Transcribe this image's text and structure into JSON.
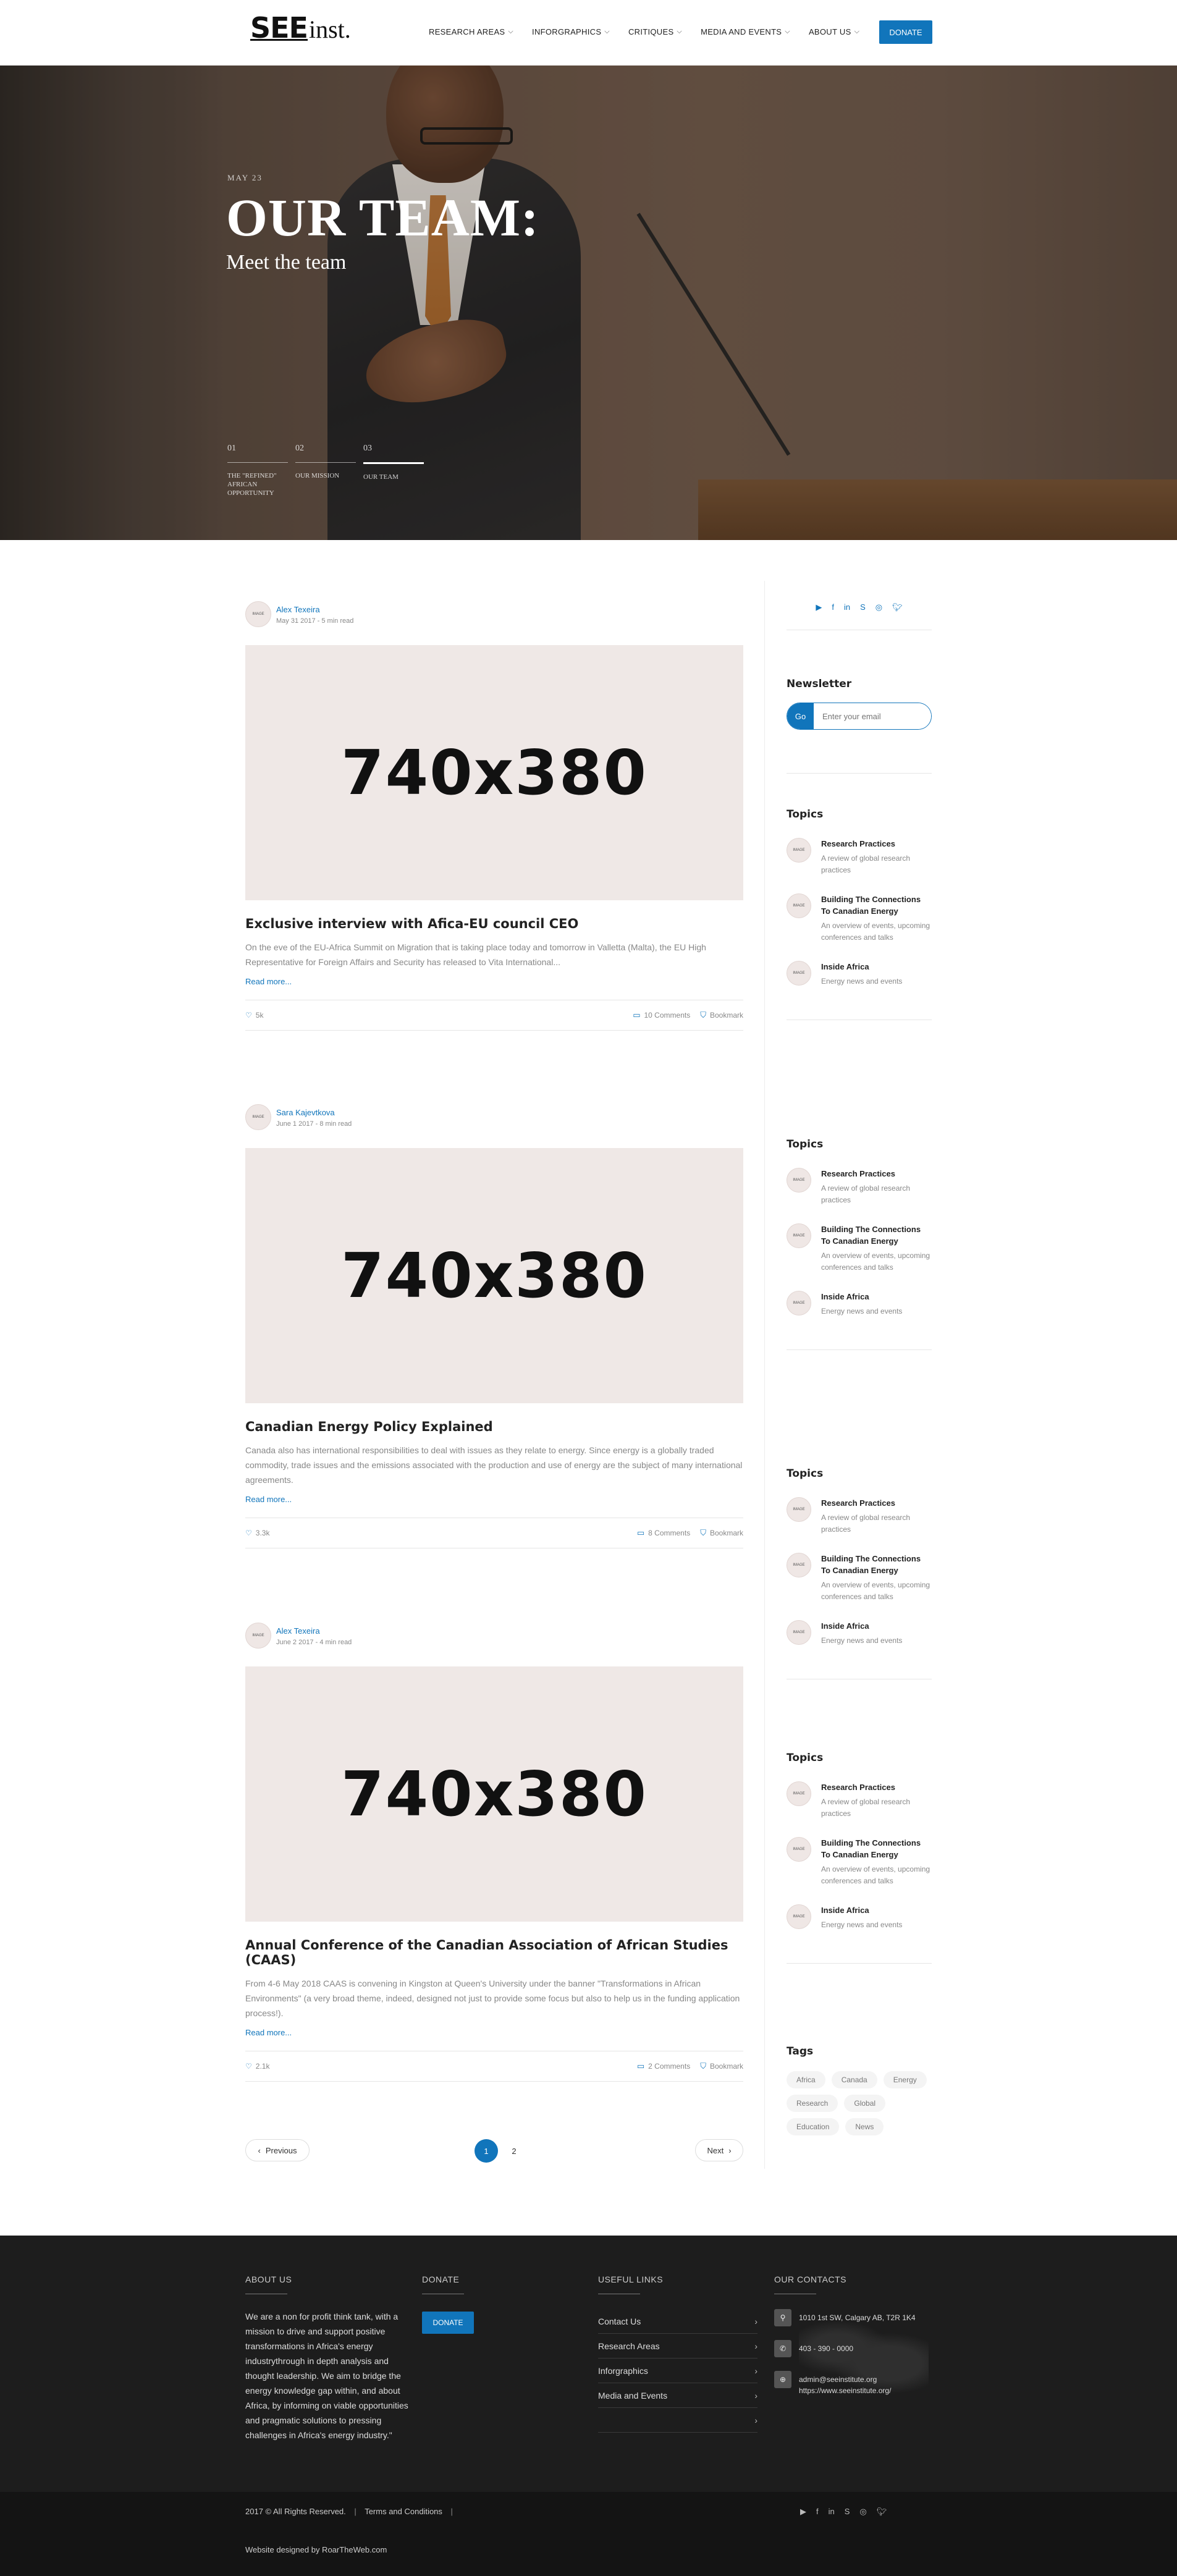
{
  "header": {
    "logo_main": "SEE",
    "logo_suffix": "inst.",
    "nav": [
      {
        "label": "RESEARCH AREAS"
      },
      {
        "label": "INFORGRAPHICS"
      },
      {
        "label": "CRITIQUES"
      },
      {
        "label": "MEDIA AND EVENTS"
      },
      {
        "label": "ABOUT US"
      }
    ],
    "donate_label": "DONATE"
  },
  "hero": {
    "date": "MAY 23",
    "title": "OUR TEAM:",
    "subtitle": "Meet the team",
    "steps": [
      {
        "num": "01",
        "label": "THE \"REFINED\" AFRICAN OPPORTUNITY"
      },
      {
        "num": "02",
        "label": "OUR MISSION"
      },
      {
        "num": "03",
        "label": "OUR TEAM"
      }
    ]
  },
  "posts": [
    {
      "author": "Alex Texeira",
      "avatar_text": "IMAGE",
      "date": "May 31 2017 - 5 min read",
      "image_text": "740x380",
      "title": "Exclusive interview with Afica-EU council CEO",
      "excerpt": "On the eve of the EU-Africa Summit on Migration that is taking place today and tomorrow in Valletta (Malta), the EU High Representative for Foreign Affairs and Security has released to Vita International...",
      "read_more": "Read more...",
      "likes": "5k",
      "comments": "10 Comments",
      "bookmark": "Bookmark"
    },
    {
      "author": "Sara Kajevtkova",
      "avatar_text": "IMAGE",
      "date": "June 1 2017 - 8 min read",
      "image_text": "740x380",
      "title": "Canadian Energy Policy Explained",
      "excerpt": "Canada also has international responsibilities to deal with issues as they relate to energy. Since energy is a globally traded commodity, trade issues and the emissions associated with the production and use of energy are the subject of many international agreements.",
      "read_more": "Read more...",
      "likes": "3.3k",
      "comments": "8 Comments",
      "bookmark": "Bookmark"
    },
    {
      "author": "Alex Texeira",
      "avatar_text": "IMAGE",
      "date": "June 2 2017 - 4 min read",
      "image_text": "740x380",
      "title": "Annual Conference of the Canadian Association of African Studies (CAAS)",
      "excerpt": "From 4-6 May 2018 CAAS is convening in Kingston at Queen's University under the banner \"Transformations in African Environments\" (a very broad theme, indeed, designed not just to provide some focus but also to help us in the funding application process!).",
      "read_more": "Read more...",
      "likes": "2.1k",
      "comments": "2 Comments",
      "bookmark": "Bookmark"
    }
  ],
  "pager": {
    "prev": "Previous",
    "next": "Next",
    "pages": [
      "1",
      "2"
    ]
  },
  "sidebar": {
    "social": [
      "youtube-icon",
      "facebook-icon",
      "linkedin-icon",
      "skype-icon",
      "instagram-icon",
      "twitter-icon"
    ],
    "newsletter_heading": "Newsletter",
    "newsletter_go": "Go",
    "newsletter_placeholder": "Enter your email",
    "topics_heading": "Topics",
    "topics": [
      {
        "avatar_text": "IMAGE",
        "title": "Research Practices",
        "desc": "A review of global research practices"
      },
      {
        "avatar_text": "IMAGE",
        "title": "Building The Connections To Canadian Energy",
        "desc": "An overview of events, upcoming conferences and talks"
      },
      {
        "avatar_text": "IMAGE",
        "title": "Inside Africa",
        "desc": "Energy news and events"
      }
    ],
    "tags_heading": "Tags",
    "tags": [
      "Africa",
      "Canada",
      "Energy",
      "Research",
      "Global",
      "Education",
      "News"
    ]
  },
  "footer": {
    "about_heading": "ABOUT US",
    "about_text": "We are a non for profit think tank, with a mission to drive and support positive transformations in Africa's energy industrythrough in depth analysis and thought leadership. We aim to bridge the energy knowledge gap within, and about Africa, by informing on viable opportunities and pragmatic solutions to pressing challenges in Africa's energy industry.\"",
    "donate_heading": "DONATE",
    "donate_label": "DONATE",
    "links_heading": "USEFUL LINKS",
    "links": [
      "Contact Us",
      "Research Areas",
      "Inforgraphics",
      "Media and Events",
      ""
    ],
    "contacts_heading": "OUR CONTACTS",
    "address": "1010 1st SW, Calgary AB, T2R 1K4",
    "phone": "403 - 390 - 0000",
    "email": "admin@seeinstitute.org",
    "website": "https://www.seeinstitute.org/",
    "copyright": "2017 © All Rights Reserved.",
    "terms": "Terms and Conditions",
    "designed_by": "Website designed by RoarTheWeb.com"
  },
  "colors": {
    "accent": "#1175bb",
    "footer_bg": "#1d1d1d",
    "footer_bottom_bg": "#141414",
    "placeholder_bg": "#efe8e6"
  }
}
